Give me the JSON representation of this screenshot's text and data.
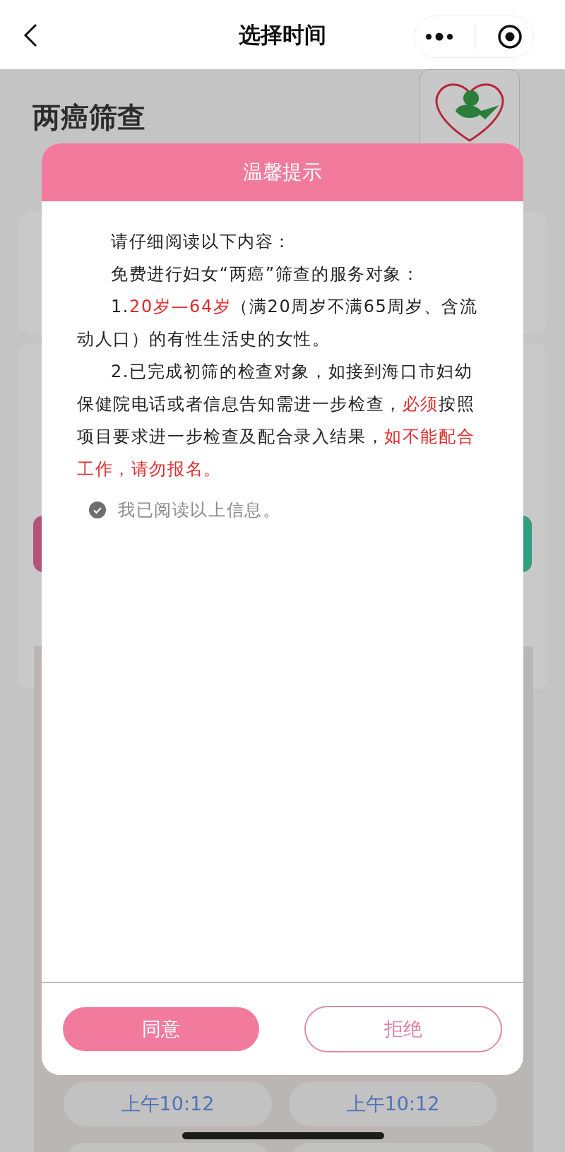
{
  "nav": {
    "title": "选择时间"
  },
  "page": {
    "title": "两癌筛查",
    "time_slots": [
      {
        "label": "上午10:12"
      },
      {
        "label": "上午10:12"
      }
    ]
  },
  "dialog": {
    "title": "温馨提示",
    "paragraphs": [
      {
        "segments": [
          {
            "text": "请仔细阅读以下内容：",
            "emphasis": false
          }
        ]
      },
      {
        "segments": [
          {
            "text": "免费进行妇女“两癌”筛查的服务对象：",
            "emphasis": false
          }
        ]
      },
      {
        "segments": [
          {
            "text": "1.",
            "emphasis": false
          },
          {
            "text": "20岁—64岁",
            "emphasis": true
          },
          {
            "text": "（满20周岁不满65周岁、含流动人口）的有性生活史的女性。",
            "emphasis": false
          }
        ]
      },
      {
        "segments": [
          {
            "text": "2.已完成初筛的检查对象，如接到海口市妇幼保健院电话或者信息告知需进一步检查，",
            "emphasis": false
          },
          {
            "text": "必须",
            "emphasis": true
          },
          {
            "text": "按照项目要求进一步检查及配合录入结果，",
            "emphasis": false
          },
          {
            "text": "如不能配合工作，请勿报名。",
            "emphasis": true
          }
        ]
      }
    ],
    "consent": {
      "label": "我已阅读以上信息。",
      "checked": true
    },
    "buttons": [
      {
        "label": "同意",
        "kind": "primary"
      },
      {
        "label": "拒绝",
        "kind": "outline"
      }
    ]
  }
}
